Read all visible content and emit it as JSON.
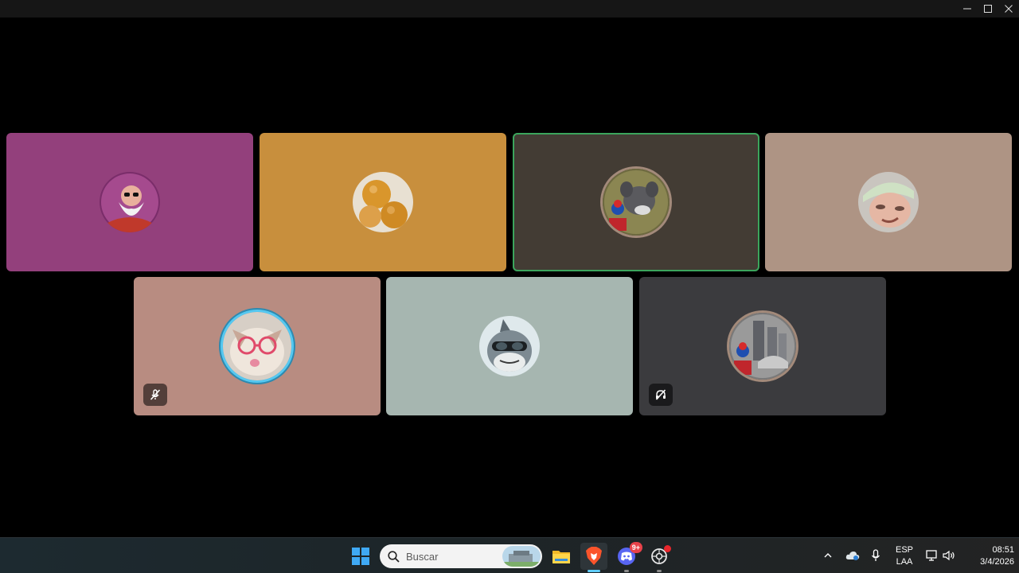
{
  "window": {
    "controls": [
      {
        "name": "minimize",
        "icon": "minimize-icon"
      },
      {
        "name": "maximize",
        "icon": "maximize-icon"
      },
      {
        "name": "close",
        "icon": "close-icon"
      }
    ]
  },
  "call": {
    "participants": [
      {
        "id": "p1",
        "tile_color": "#93407c",
        "avatar": "old-master-avatar",
        "speaking": false,
        "status_icon": null
      },
      {
        "id": "p2",
        "tile_color": "#c88f3d",
        "avatar": "bread-balls-avatar",
        "speaking": false,
        "status_icon": null
      },
      {
        "id": "p3",
        "tile_color": "#433c34",
        "avatar": "cartoon-cat-avatar",
        "speaking": true,
        "status_icon": null
      },
      {
        "id": "p4",
        "tile_color": "#ae9484",
        "avatar": "person-cap-avatar",
        "speaking": false,
        "status_icon": null
      },
      {
        "id": "p5",
        "tile_color": "#b88c81",
        "avatar": "cat-glasses-avatar",
        "speaking": false,
        "status_icon": "mic-muted-icon"
      },
      {
        "id": "p6",
        "tile_color": "#a6b6b0",
        "avatar": "shark-goggles-avatar",
        "speaking": false,
        "status_icon": null
      },
      {
        "id": "p7",
        "tile_color": "#3b3b3e",
        "avatar": "city-figure-avatar",
        "speaking": false,
        "status_icon": "deafened-icon"
      }
    ]
  },
  "taskbar": {
    "search": {
      "placeholder": "Buscar"
    },
    "apps": [
      {
        "name": "start",
        "icon": "windows-logo-icon"
      },
      {
        "name": "file-explorer",
        "icon": "folder-icon"
      },
      {
        "name": "brave",
        "icon": "brave-lion-icon",
        "active": true
      },
      {
        "name": "discord",
        "icon": "discord-icon",
        "badge": "9+"
      },
      {
        "name": "screen-recorder",
        "icon": "record-icon"
      }
    ],
    "tray": {
      "language_line1": "ESP",
      "language_line2": "LAA",
      "time": "08:51",
      "date": "3/4/2026"
    }
  },
  "colors": {
    "speaking_border": "#3ba55c",
    "taskbar_bg": "#1f272b",
    "accent": "#60cdff"
  }
}
